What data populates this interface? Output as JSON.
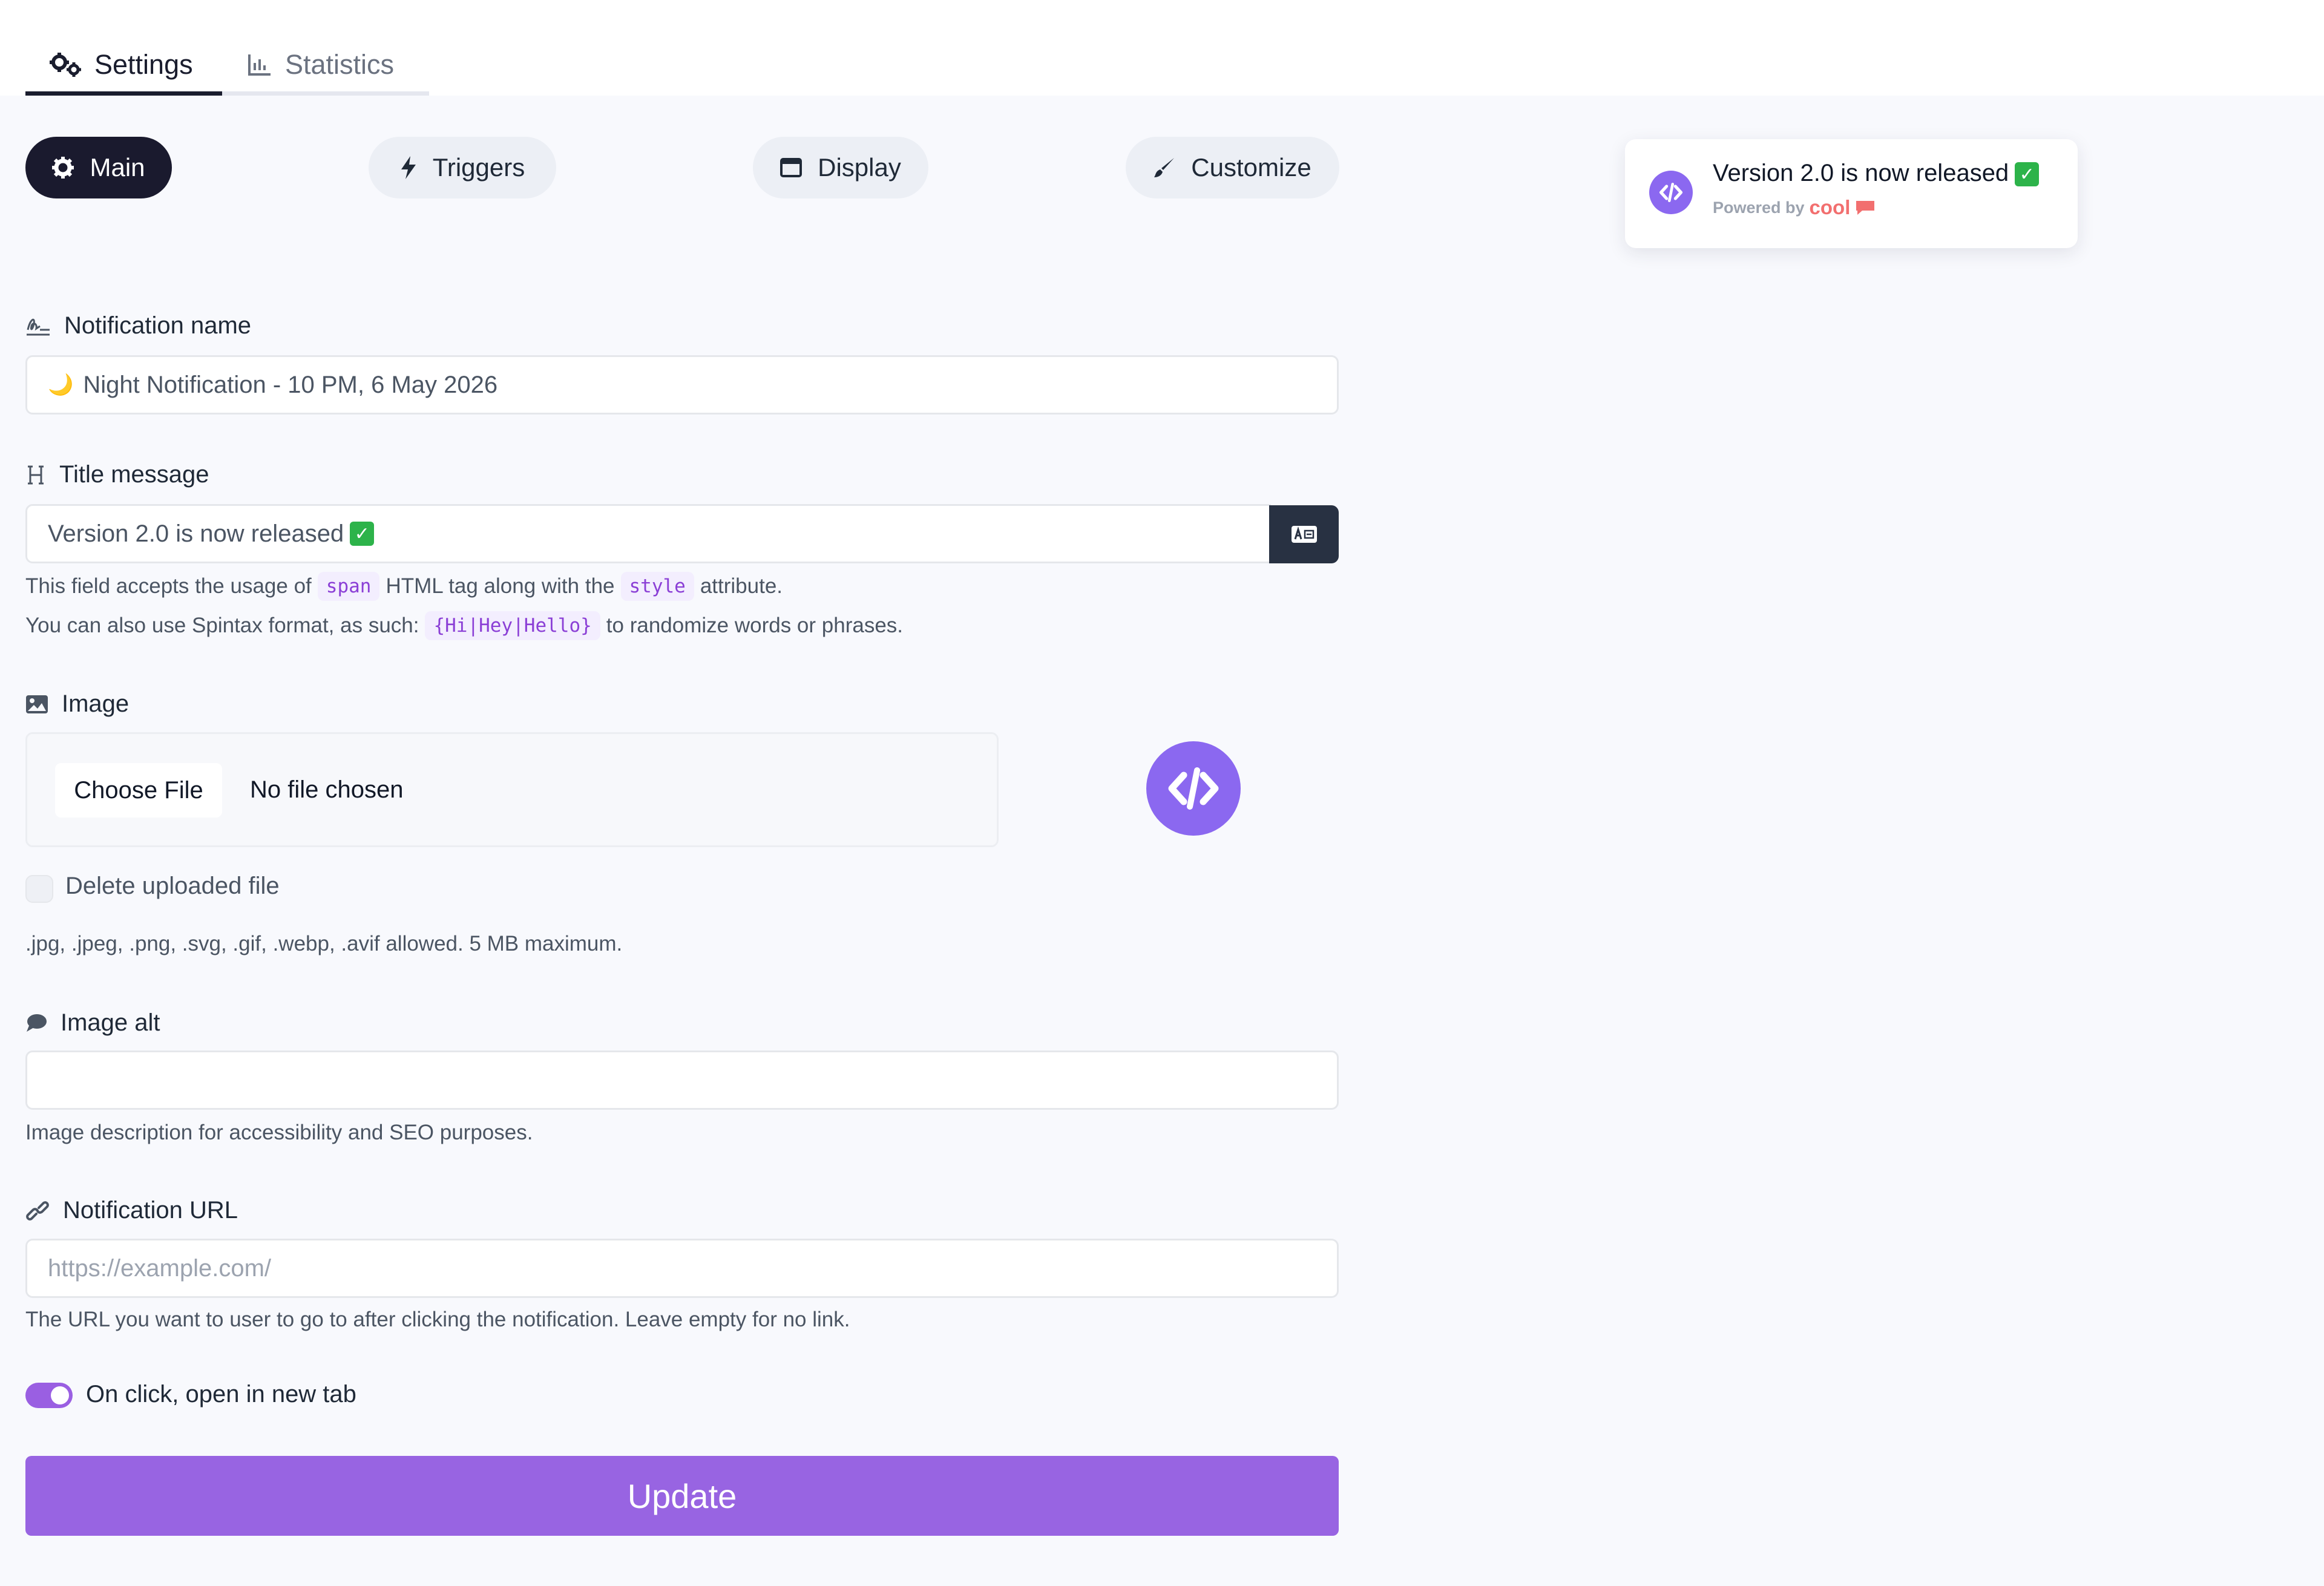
{
  "tabs": {
    "settings": "Settings",
    "statistics": "Statistics"
  },
  "subtabs": {
    "main": "Main",
    "triggers": "Triggers",
    "display": "Display",
    "customize": "Customize"
  },
  "fields": {
    "name": {
      "label": "Notification name",
      "value": "Night Notification - 10 PM, 6 May 2026",
      "prefix_emoji": "🌙"
    },
    "title": {
      "label": "Title message",
      "value": "Version 2.0 is now released",
      "check": "✓",
      "help1_a": "This field accepts the usage of",
      "help1_tag1": "span",
      "help1_b": "HTML tag along with the",
      "help1_tag2": "style",
      "help1_c": "attribute.",
      "help2_a": "You can also use Spintax format, as such:",
      "help2_tag": "{Hi|Hey|Hello}",
      "help2_b": "to randomize words or phrases."
    },
    "image": {
      "label": "Image",
      "choose_button": "Choose File",
      "no_file": "No file chosen",
      "delete_label": "Delete uploaded file",
      "help": ".jpg, .jpeg, .png, .svg, .gif, .webp, .avif allowed. 5 MB maximum."
    },
    "image_alt": {
      "label": "Image alt",
      "value": "",
      "help": "Image description for accessibility and SEO purposes."
    },
    "url": {
      "label": "Notification URL",
      "placeholder": "https://example.com/",
      "help": "The URL you want to user to go to after clicking the notification. Leave empty for no link."
    },
    "new_tab": {
      "label": "On click, open in new tab",
      "enabled": true
    }
  },
  "update_button": "Update",
  "preview": {
    "title": "Version 2.0 is now released",
    "check": "✓",
    "powered_by": "Powered by",
    "brand": "cool"
  },
  "colors": {
    "accent": "#9864e2",
    "dark": "#1a1a2e",
    "icon_purple": "#8b68f0",
    "brand": "#f26f6f"
  },
  "icons": {
    "settings_tab": "gears-icon",
    "statistics_tab": "chart-icon",
    "main": "gear-icon",
    "triggers": "bolt-icon",
    "display": "window-icon",
    "customize": "brush-icon",
    "name": "signature-icon",
    "title": "heading-icon",
    "image": "image-icon",
    "image_alt": "comment-icon",
    "url": "link-icon",
    "code": "code-icon"
  }
}
